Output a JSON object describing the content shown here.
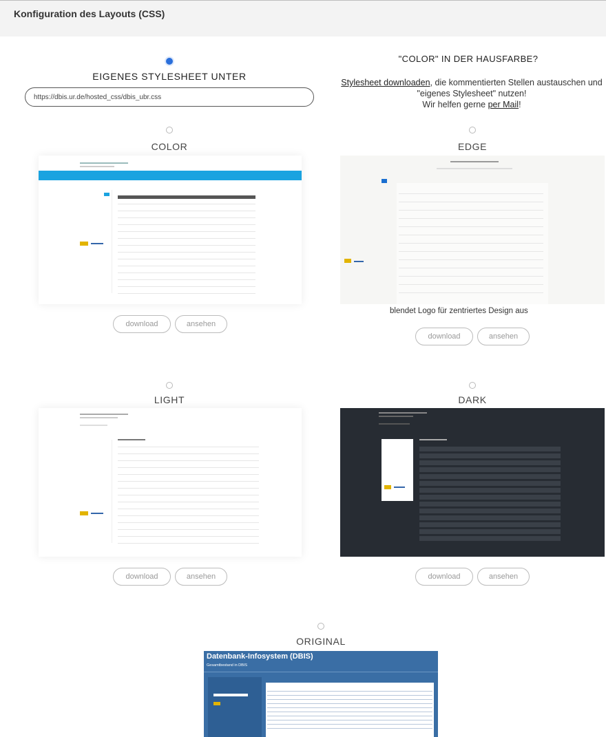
{
  "header": {
    "title": "Konfiguration des Layouts (CSS)"
  },
  "custom": {
    "label": "EIGENES STYLESHEET UNTER",
    "url_value": "https://dbis.ur.de/hosted_css/dbis_ubr.css",
    "selected": true
  },
  "hint": {
    "title": "\"COLOR\" IN DER HAUSFARBE?",
    "link_download": "Stylesheet downloaden",
    "text_after_link": ", die kommentierten Stellen austauschen und \"eigenes Stylesheet\" nutzen!",
    "text_help": "Wir helfen gerne ",
    "link_mail": "per Mail",
    "text_end": "!"
  },
  "options": {
    "color": {
      "label": "COLOR",
      "download": "download",
      "view": "ansehen",
      "accent": "#1aa3e0"
    },
    "edge": {
      "label": "EDGE",
      "description": "blendet Logo für zentriertes Design aus",
      "download": "download",
      "view": "ansehen"
    },
    "light": {
      "label": "LIGHT",
      "download": "download",
      "view": "ansehen"
    },
    "dark": {
      "label": "DARK",
      "download": "download",
      "view": "ansehen",
      "accent": "#272c33"
    },
    "original": {
      "label": "ORIGINAL",
      "preview_title": "Datenbank-Infosystem (DBIS)",
      "preview_subtitle": "Gesamtbestand in DBIS",
      "accent": "#3a6ea5"
    }
  }
}
